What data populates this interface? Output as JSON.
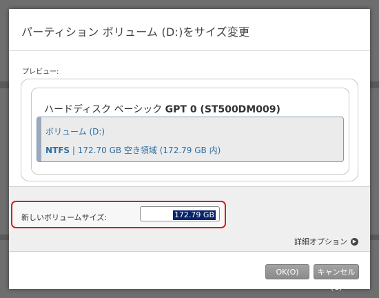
{
  "dialog": {
    "title": "パーティション ボリューム (D:)をサイズ変更",
    "preview_label": "プレビュー:"
  },
  "disk": {
    "title_prefix": "ハードディスク ベーシック ",
    "title_bold": "GPT 0 (ST500DM009)",
    "volume": {
      "name": "ボリューム (D:)",
      "filesystem": "NTFS",
      "separator": "|",
      "info": "172.70 GB 空き領域 (172.79 GB 内)"
    }
  },
  "resize": {
    "label": "新しいボリュームサイズ:",
    "value": "172.79 GB"
  },
  "detail_options": {
    "label": "詳細オプション",
    "icon": "arrow-right-circle-icon"
  },
  "buttons": {
    "ok": "OK(O)",
    "cancel": "キャンセル(C)"
  },
  "colors": {
    "highlight_border": "#d11f1f",
    "volume_text": "#2d6fa3",
    "selection_bg": "#0a246a"
  }
}
